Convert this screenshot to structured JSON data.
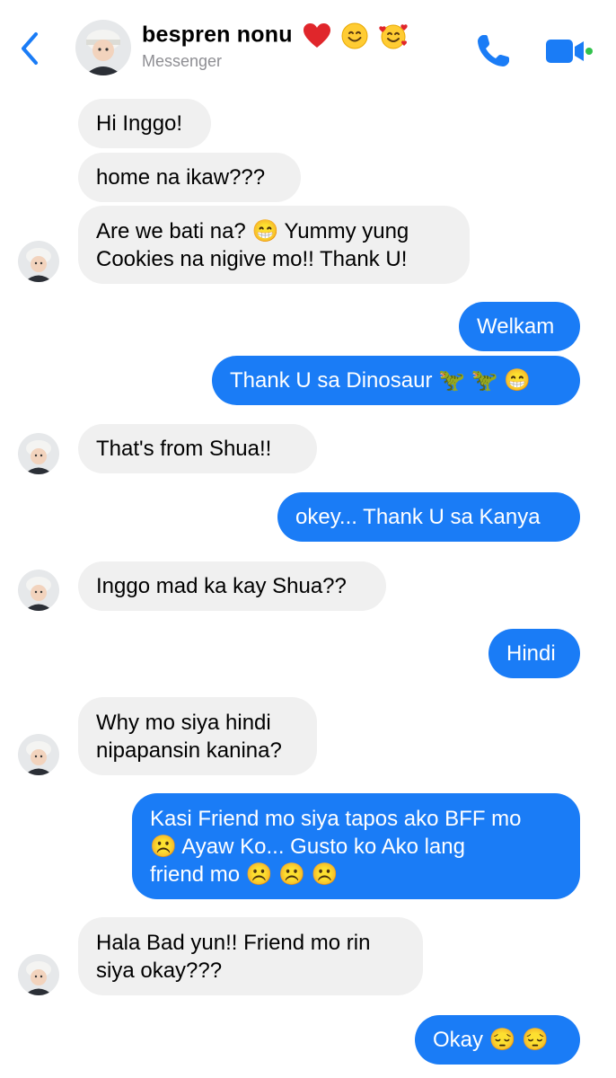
{
  "header": {
    "contact_name": "bespren nonu",
    "subtitle": "Messenger",
    "name_emojis": [
      "red-heart",
      "smiling-face",
      "smiling-face-with-hearts"
    ]
  },
  "messages": [
    {
      "side": "in",
      "text": "Hi Inggo!"
    },
    {
      "side": "in",
      "text": "home na ikaw???"
    },
    {
      "side": "in",
      "text": "Are we bati na? 😁 Yummy yung\nCookies na nigive mo!! Thank U!"
    },
    {
      "side": "out",
      "text": "Welkam"
    },
    {
      "side": "out",
      "text": "Thank U sa Dinosaur 🦖 🦖 😁"
    },
    {
      "side": "in",
      "text": "That's from Shua!!"
    },
    {
      "side": "out",
      "text": "okey... Thank U sa Kanya"
    },
    {
      "side": "in",
      "text": "Inggo mad ka kay Shua??"
    },
    {
      "side": "out",
      "text": "Hindi"
    },
    {
      "side": "in",
      "text": "Why mo siya hindi\nnipapansin kanina?"
    },
    {
      "side": "out",
      "text": "Kasi Friend mo siya tapos ako BFF mo\n☹️ Ayaw Ko... Gusto ko Ako lang\nfriend mo ☹️ ☹️ ☹️"
    },
    {
      "side": "in",
      "text": "Hala Bad yun!! Friend mo rin\nsiya okay???"
    },
    {
      "side": "out",
      "text": "Okay 😔 😔"
    }
  ],
  "colors": {
    "accent": "#1a7cf6",
    "incoming_bubble": "#f0f0f0",
    "subtitle": "#8e8e93"
  }
}
